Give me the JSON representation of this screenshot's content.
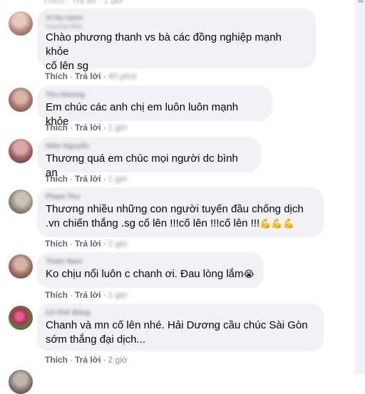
{
  "actions": {
    "like": "Thích",
    "reply": "Trả lời",
    "separator": "·"
  },
  "comments": [
    {
      "author": "Vi Ha Uyen",
      "sub": "Hoai Kiet Hinh",
      "text": "Chào phương thanh vs bà các đồng nghiệp mạnh khỏe\ncố lên sg",
      "emoji": "",
      "time": "40 phút"
    },
    {
      "author": "Thu Hương",
      "sub": "",
      "text": "Em chúc các anh chị em luôn luôn mạnh khỏe",
      "emoji": "",
      "time": "1 giờ"
    },
    {
      "author": "Hiền Nguyễn",
      "sub": "",
      "text": "Thương quá em chúc mọi người dc bình an",
      "emoji": "",
      "time": "1 giờ"
    },
    {
      "author": "Phạm Thu",
      "sub": "",
      "text": "Thương nhiều những con người tuyến đầu chống dịch\n.vn chiến thắng .sg cố lên !!!cố lên !!!cố lên !!!",
      "emoji": "💪💪💪",
      "time": "2 giờ"
    },
    {
      "author": "Thiên Nam",
      "sub": "",
      "text": "Ko chịu nổi luôn c chanh ơi. Đau lòng lắm",
      "emoji": "😭",
      "time": "1 giờ"
    },
    {
      "author": "Cô Phê Bông",
      "sub": "",
      "text": "Chanh và mn cố lên nhé. Hải Dương cầu chúc Sài Gòn\nsớm thắng đại dịch...",
      "emoji": "",
      "time": "2 giờ"
    }
  ],
  "colors": {
    "bubble": "#f0f2f5",
    "action_text": "#65676b",
    "text": "#050505"
  }
}
